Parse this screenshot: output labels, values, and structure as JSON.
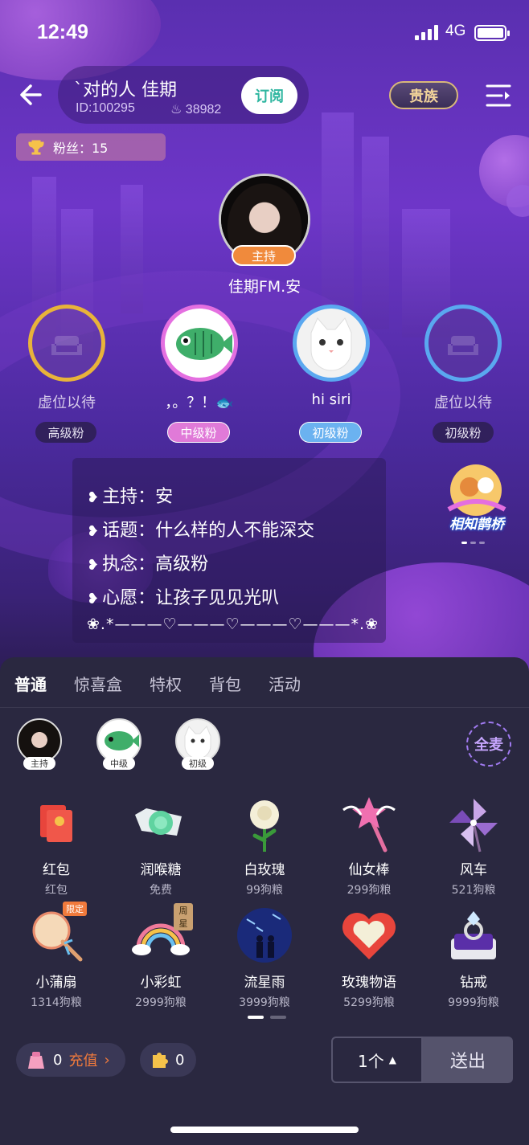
{
  "status": {
    "time": "12:49",
    "network": "4G"
  },
  "room": {
    "name": "`对的人        佳期",
    "id": "ID:100295",
    "hot": "38982",
    "subscribe": "订阅",
    "noble": "贵族",
    "fans": "粉丝：15"
  },
  "host": {
    "tag": "主持",
    "name": "佳期FM.安"
  },
  "seats": [
    {
      "name": "虚位以待",
      "badge": "高级粉"
    },
    {
      "name": "，。？！🐟",
      "badge": "中级粉"
    },
    {
      "name": "hi siri",
      "badge": "初级粉"
    },
    {
      "name": "虚位以待",
      "badge": "初级粉"
    }
  ],
  "notice": {
    "lines": [
      "主持：安",
      "话题：什么样的人不能深交",
      "执念：高级粉",
      "心愿：让孩子见见光叭"
    ],
    "deco": "❀.*———♡———♡———♡———*.❀"
  },
  "promo": {
    "label": "相知鹊桥"
  },
  "panel": {
    "tabs": [
      "普通",
      "惊喜盒",
      "特权",
      "背包",
      "活动"
    ],
    "mics": [
      "主持",
      "中级",
      "初级"
    ],
    "all_mic": "全麦",
    "gifts": [
      {
        "name": "红包",
        "price": "红包",
        "icon": "red-envelope-icon"
      },
      {
        "name": "润喉糖",
        "price": "免费",
        "icon": "candy-icon"
      },
      {
        "name": "白玫瑰",
        "price": "99狗粮",
        "icon": "white-rose-icon"
      },
      {
        "name": "仙女棒",
        "price": "299狗粮",
        "icon": "fairy-wand-icon"
      },
      {
        "name": "风车",
        "price": "521狗粮",
        "icon": "pinwheel-icon"
      },
      {
        "name": "小蒲扇",
        "price": "1314狗粮",
        "icon": "fan-icon",
        "tag": "限定"
      },
      {
        "name": "小彩虹",
        "price": "2999狗粮",
        "icon": "rainbow-icon",
        "tag": "周星"
      },
      {
        "name": "流星雨",
        "price": "3999狗粮",
        "icon": "meteor-icon"
      },
      {
        "name": "玫瑰物语",
        "price": "5299狗粮",
        "icon": "rose-heart-icon"
      },
      {
        "name": "钻戒",
        "price": "9999狗粮",
        "icon": "diamond-ring-icon"
      }
    ],
    "balance": "0",
    "recharge": "充值",
    "puzzle_balance": "0",
    "quantity": "1个",
    "send": "送出"
  }
}
